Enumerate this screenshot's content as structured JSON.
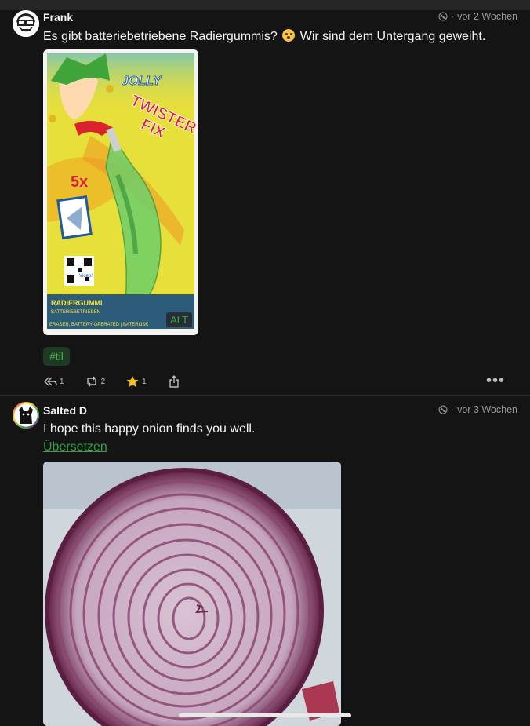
{
  "posts": [
    {
      "author": "Frank",
      "time": "vor 2 Wochen",
      "text_before": "Es gibt batteriebetriebene Radiergummis?",
      "text_after": "Wir sind dem Untergang geweiht.",
      "media": {
        "alt": "ALT",
        "brand": "JOLLY",
        "product_line1": "TWISTER",
        "product_line2": "FIX",
        "count": "5x",
        "qr_label": "Video!",
        "caption1": "RADIERGUMMI",
        "caption2": "BATTERIEBETRIEBEN",
        "caption3": "ERASER, BATTERY-OPERATED | BATERIJSK"
      },
      "hashtag": "#til",
      "replies": "1",
      "boosts": "2",
      "favourites": "1"
    },
    {
      "author": "Salted D",
      "time": "vor 3 Wochen",
      "text": "I hope this happy onion finds you well.",
      "translate": "Übersetzen"
    }
  ],
  "colors": {
    "background": "#141414",
    "accent_green": "#34a043",
    "star": "#f5c518"
  }
}
